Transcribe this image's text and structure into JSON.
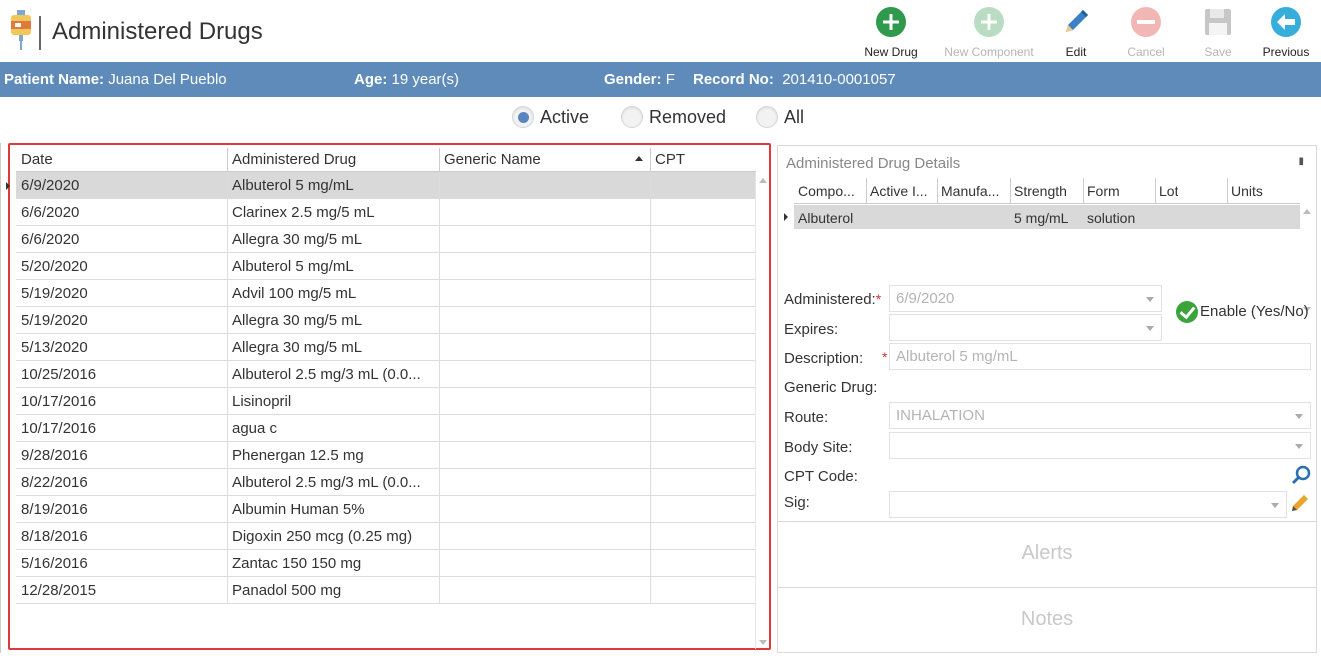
{
  "header": {
    "title": "Administered Drugs",
    "toolbar": [
      {
        "name": "new-drug-button",
        "label": "New Drug",
        "icon": "plus-circle-icon",
        "enabled": true
      },
      {
        "name": "new-component-button",
        "label": "New Component",
        "icon": "plus-circle-icon",
        "enabled": false
      },
      {
        "name": "edit-button",
        "label": "Edit",
        "icon": "pencil-icon",
        "enabled": true
      },
      {
        "name": "cancel-button",
        "label": "Cancel",
        "icon": "minus-circle-icon",
        "enabled": false
      },
      {
        "name": "save-button",
        "label": "Save",
        "icon": "floppy-disk-icon",
        "enabled": false
      },
      {
        "name": "previous-button",
        "label": "Previous",
        "icon": "arrow-left-circle-icon",
        "enabled": true
      }
    ]
  },
  "patient": {
    "name_label": "Patient Name:",
    "name": "Juana Del Pueblo",
    "age_label": "Age:",
    "age": "19 year(s)",
    "gender_label": "Gender:",
    "gender": "F",
    "record_label": "Record No:",
    "record": "201410-0001057"
  },
  "filter": {
    "options": [
      "Active",
      "Removed",
      "All"
    ],
    "selected": "Active"
  },
  "grid": {
    "columns": [
      "Date",
      "Administered Drug",
      "Generic Name",
      "CPT"
    ],
    "rows": [
      [
        "6/9/2020",
        "Albuterol 5 mg/mL",
        "",
        ""
      ],
      [
        "6/6/2020",
        "Clarinex 2.5 mg/5 mL",
        "",
        ""
      ],
      [
        "6/6/2020",
        "Allegra 30 mg/5 mL",
        "",
        ""
      ],
      [
        "5/20/2020",
        "Albuterol 5 mg/mL",
        "",
        ""
      ],
      [
        "5/19/2020",
        "Advil 100 mg/5 mL",
        "",
        ""
      ],
      [
        "5/19/2020",
        "Allegra 30 mg/5 mL",
        "",
        ""
      ],
      [
        "5/13/2020",
        "Allegra 30 mg/5 mL",
        "",
        ""
      ],
      [
        "10/25/2016",
        "Albuterol 2.5 mg/3 mL (0.0...",
        "",
        ""
      ],
      [
        "10/17/2016",
        "Lisinopril",
        "",
        ""
      ],
      [
        "10/17/2016",
        "agua c",
        "",
        ""
      ],
      [
        "9/28/2016",
        "Phenergan 12.5 mg",
        "",
        ""
      ],
      [
        "8/22/2016",
        "Albuterol 2.5 mg/3 mL (0.0...",
        "",
        ""
      ],
      [
        "8/19/2016",
        "Albumin Human 5%",
        "",
        ""
      ],
      [
        "8/18/2016",
        "Digoxin 250 mcg (0.25 mg)",
        "",
        ""
      ],
      [
        "5/16/2016",
        "Zantac 150 150 mg",
        "",
        ""
      ],
      [
        "12/28/2015",
        "Panadol 500 mg",
        "",
        ""
      ]
    ]
  },
  "details": {
    "title": "Administered Drug Details",
    "components_columns": [
      "Compo...",
      "Active I...",
      "Manufa...",
      "Strength",
      "Form",
      "Lot",
      "Units"
    ],
    "component_row": [
      "Albuterol",
      "",
      "",
      "5 mg/mL",
      "solution",
      "",
      ""
    ],
    "fields": {
      "administered_label": "Administered:",
      "administered_value": "6/9/2020",
      "expires_label": "Expires:",
      "expires_value": "",
      "description_label": "Description:",
      "description_value": "Albuterol 5 mg/mL",
      "generic_label": "Generic Drug:",
      "route_label": "Route:",
      "route_value": "INHALATION",
      "body_site_label": "Body Site:",
      "body_site_value": "",
      "cpt_label": "CPT Code:",
      "sig_label": "Sig:",
      "sig_value": "",
      "enable_label": "Enable (Yes/No)"
    },
    "alerts_label": "Alerts",
    "notes_label": "Notes"
  }
}
